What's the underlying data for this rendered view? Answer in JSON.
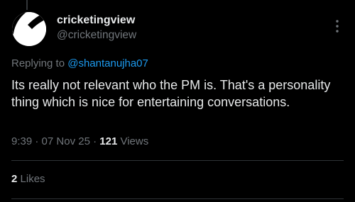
{
  "tweet": {
    "author": {
      "display_name": "cricketingview",
      "handle": "@cricketingview"
    },
    "replying_prefix": "Replying to",
    "replying_to": "@shantanujha07",
    "text": "Its really not relevant who the PM is. That's a personality thing which is nice for entertaining conversations.",
    "time": "9:39",
    "date": "07 Nov 25",
    "views_count": "121",
    "views_label": "Views",
    "separator": "·",
    "likes_count": "2",
    "likes_label": "Likes"
  },
  "icons": {
    "more": "more-vertical-icon",
    "avatar": "avatar-image"
  },
  "colors": {
    "background": "#000000",
    "text_primary": "#e7e9ea",
    "text_secondary": "#71767b",
    "link": "#1d9bf0",
    "divider": "#2f3336"
  }
}
